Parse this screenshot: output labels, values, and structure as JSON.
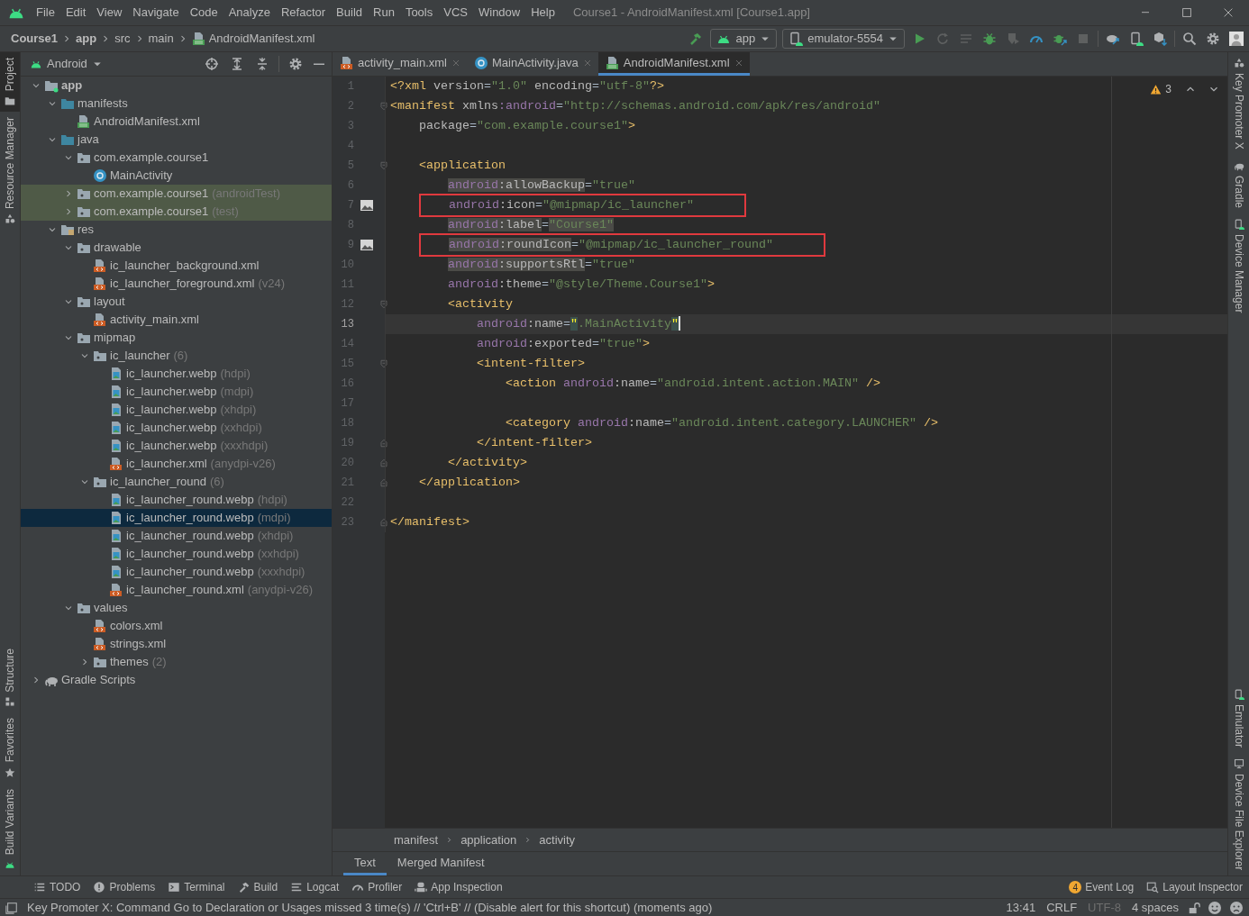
{
  "window": {
    "title": "Course1 - AndroidManifest.xml [Course1.app]"
  },
  "menu": [
    "File",
    "Edit",
    "View",
    "Navigate",
    "Code",
    "Analyze",
    "Refactor",
    "Build",
    "Run",
    "Tools",
    "VCS",
    "Window",
    "Help"
  ],
  "breadcrumb": [
    {
      "text": "Course1",
      "bold": true,
      "kind": "plain"
    },
    {
      "text": "app",
      "bold": true,
      "kind": "plain"
    },
    {
      "text": "src",
      "bold": false,
      "kind": "plain"
    },
    {
      "text": "main",
      "bold": false,
      "kind": "plain"
    },
    {
      "text": "AndroidManifest.xml",
      "bold": false,
      "kind": "manifest"
    }
  ],
  "run_config": "app",
  "device": "emulator-5554",
  "left_strip": {
    "top": [
      {
        "label": "Project",
        "selected": true
      },
      {
        "label": "Resource Manager",
        "selected": false
      }
    ],
    "bottom": [
      {
        "label": "Structure",
        "selected": false
      },
      {
        "label": "Favorites",
        "selected": false
      },
      {
        "label": "Build Variants",
        "selected": false
      }
    ]
  },
  "right_strip": {
    "top": [
      "Key Promoter X",
      "Gradle",
      "Device Manager"
    ],
    "bottom": [
      "Emulator",
      "Device File Explorer"
    ]
  },
  "project": {
    "view": "Android",
    "tree": [
      {
        "label": "app",
        "kind": "module",
        "expanded": true,
        "selected": false,
        "tinted": false,
        "children": [
          {
            "label": "manifests",
            "kind": "folder-blue",
            "expanded": true,
            "selected": false,
            "tinted": false,
            "children": [
              {
                "label": "AndroidManifest.xml",
                "kind": "manifest",
                "selected": false,
                "tinted": false
              }
            ]
          },
          {
            "label": "java",
            "kind": "folder-blue",
            "expanded": true,
            "selected": false,
            "tinted": false,
            "children": [
              {
                "label": "com.example.course1",
                "kind": "package",
                "expanded": true,
                "selected": false,
                "tinted": false,
                "children": [
                  {
                    "label": "MainActivity",
                    "kind": "class",
                    "selected": false,
                    "tinted": false
                  }
                ]
              },
              {
                "label": "com.example.course1",
                "note": "(androidTest)",
                "kind": "package",
                "expanded": false,
                "selected": false,
                "tinted": true
              },
              {
                "label": "com.example.course1",
                "note": "(test)",
                "kind": "package",
                "expanded": false,
                "selected": false,
                "tinted": true
              }
            ]
          },
          {
            "label": "res",
            "kind": "res",
            "expanded": true,
            "selected": false,
            "tinted": false,
            "children": [
              {
                "label": "drawable",
                "kind": "package",
                "expanded": true,
                "selected": false,
                "tinted": false,
                "children": [
                  {
                    "label": "ic_launcher_background.xml",
                    "kind": "xml",
                    "selected": false,
                    "tinted": false
                  },
                  {
                    "label": "ic_launcher_foreground.xml",
                    "note": "(v24)",
                    "kind": "xml",
                    "selected": false,
                    "tinted": false
                  }
                ]
              },
              {
                "label": "layout",
                "kind": "package",
                "expanded": true,
                "selected": false,
                "tinted": false,
                "children": [
                  {
                    "label": "activity_main.xml",
                    "kind": "xml",
                    "selected": false,
                    "tinted": false
                  }
                ]
              },
              {
                "label": "mipmap",
                "kind": "package",
                "expanded": true,
                "selected": false,
                "tinted": false,
                "children": [
                  {
                    "label": "ic_launcher",
                    "note": "(6)",
                    "kind": "package",
                    "expanded": true,
                    "selected": false,
                    "tinted": false,
                    "children": [
                      {
                        "label": "ic_launcher.webp",
                        "note": "(hdpi)",
                        "kind": "image",
                        "selected": false,
                        "tinted": false
                      },
                      {
                        "label": "ic_launcher.webp",
                        "note": "(mdpi)",
                        "kind": "image",
                        "selected": false,
                        "tinted": false
                      },
                      {
                        "label": "ic_launcher.webp",
                        "note": "(xhdpi)",
                        "kind": "image",
                        "selected": false,
                        "tinted": false
                      },
                      {
                        "label": "ic_launcher.webp",
                        "note": "(xxhdpi)",
                        "kind": "image",
                        "selected": false,
                        "tinted": false
                      },
                      {
                        "label": "ic_launcher.webp",
                        "note": "(xxxhdpi)",
                        "kind": "image",
                        "selected": false,
                        "tinted": false
                      },
                      {
                        "label": "ic_launcher.xml",
                        "note": "(anydpi-v26)",
                        "kind": "xml",
                        "selected": false,
                        "tinted": false
                      }
                    ]
                  },
                  {
                    "label": "ic_launcher_round",
                    "note": "(6)",
                    "kind": "package",
                    "expanded": true,
                    "selected": false,
                    "tinted": false,
                    "children": [
                      {
                        "label": "ic_launcher_round.webp",
                        "note": "(hdpi)",
                        "kind": "image",
                        "selected": false,
                        "tinted": false
                      },
                      {
                        "label": "ic_launcher_round.webp",
                        "note": "(mdpi)",
                        "kind": "image",
                        "selected": true,
                        "tinted": false
                      },
                      {
                        "label": "ic_launcher_round.webp",
                        "note": "(xhdpi)",
                        "kind": "image",
                        "selected": false,
                        "tinted": false
                      },
                      {
                        "label": "ic_launcher_round.webp",
                        "note": "(xxhdpi)",
                        "kind": "image",
                        "selected": false,
                        "tinted": false
                      },
                      {
                        "label": "ic_launcher_round.webp",
                        "note": "(xxxhdpi)",
                        "kind": "image",
                        "selected": false,
                        "tinted": false
                      },
                      {
                        "label": "ic_launcher_round.xml",
                        "note": "(anydpi-v26)",
                        "kind": "xml",
                        "selected": false,
                        "tinted": false
                      }
                    ]
                  }
                ]
              },
              {
                "label": "values",
                "kind": "package",
                "expanded": true,
                "selected": false,
                "tinted": false,
                "children": [
                  {
                    "label": "colors.xml",
                    "kind": "xml",
                    "selected": false,
                    "tinted": false
                  },
                  {
                    "label": "strings.xml",
                    "kind": "xml",
                    "selected": false,
                    "tinted": false
                  },
                  {
                    "label": "themes",
                    "note": "(2)",
                    "kind": "package",
                    "expanded": false,
                    "selected": false,
                    "tinted": false
                  }
                ]
              }
            ]
          }
        ]
      },
      {
        "label": "Gradle Scripts",
        "kind": "gradle",
        "expanded": false,
        "selected": false,
        "tinted": false
      }
    ]
  },
  "editor": {
    "tabs": [
      {
        "label": "activity_main.xml",
        "kind": "xml",
        "selected": false
      },
      {
        "label": "MainActivity.java",
        "kind": "class",
        "selected": false
      },
      {
        "label": "AndroidManifest.xml",
        "kind": "manifest",
        "selected": true
      }
    ],
    "warnings": "3",
    "lines": [
      {
        "number": "1",
        "current": false,
        "boxed": false,
        "gutter_icon": false,
        "tokens": [
          {
            "kind": "tag",
            "text": "<?xml"
          },
          {
            "kind": "attr",
            "text": " version"
          },
          {
            "kind": "p",
            "text": "="
          },
          {
            "kind": "str",
            "text": "\"1.0\""
          },
          {
            "kind": "attr",
            "text": " encoding"
          },
          {
            "kind": "p",
            "text": "="
          },
          {
            "kind": "str",
            "text": "\"utf-8\""
          },
          {
            "kind": "tag",
            "text": "?>"
          }
        ]
      },
      {
        "number": "2",
        "current": false,
        "boxed": false,
        "gutter_icon": false,
        "fold": {
          "kind": "start"
        },
        "tokens": [
          {
            "kind": "tag",
            "text": "<manifest"
          },
          {
            "kind": "attr",
            "text": " xmlns"
          },
          {
            "kind": "ns",
            "text": ":android"
          },
          {
            "kind": "p",
            "text": "="
          },
          {
            "kind": "str",
            "text": "\"http://schemas.android.com/apk/res/android\""
          }
        ]
      },
      {
        "number": "3",
        "current": false,
        "boxed": false,
        "gutter_icon": false,
        "tokens": [
          {
            "kind": "attr",
            "text": "    package"
          },
          {
            "kind": "p",
            "text": "="
          },
          {
            "kind": "str",
            "text": "\"com.example.course1\""
          },
          {
            "kind": "tag",
            "text": ">"
          }
        ]
      },
      {
        "number": "4",
        "current": false,
        "boxed": false,
        "gutter_icon": false
      },
      {
        "number": "5",
        "current": false,
        "boxed": false,
        "gutter_icon": false,
        "fold": {
          "kind": "start"
        },
        "tokens": [
          {
            "kind": "tag",
            "text": "    <application"
          }
        ]
      },
      {
        "number": "6",
        "current": false,
        "boxed": false,
        "gutter_icon": false,
        "tokens": [
          {
            "kind": "ns_hl",
            "text": "        android"
          },
          {
            "kind": "attr_hl",
            "text": ":allowBackup"
          },
          {
            "kind": "p",
            "text": "="
          },
          {
            "kind": "str",
            "text": "\"true\""
          }
        ]
      },
      {
        "number": "7",
        "current": false,
        "boxed": true,
        "gutter_icon": true,
        "tokens": [
          {
            "kind": "ns",
            "text": "        android"
          },
          {
            "kind": "attr",
            "text": ":icon"
          },
          {
            "kind": "p",
            "text": "="
          },
          {
            "kind": "str",
            "text": "\"@mipmap/ic_launcher\""
          }
        ]
      },
      {
        "number": "8",
        "current": false,
        "boxed": false,
        "gutter_icon": false,
        "tokens": [
          {
            "kind": "ns_hl",
            "text": "        android"
          },
          {
            "kind": "attr_hl",
            "text": ":label"
          },
          {
            "kind": "p",
            "text": "="
          },
          {
            "kind": "str_hl",
            "text": "\"Course1\""
          }
        ]
      },
      {
        "number": "9",
        "current": false,
        "boxed": true,
        "gutter_icon": true,
        "tokens": [
          {
            "kind": "ns_hl",
            "text": "        android"
          },
          {
            "kind": "attr_hl",
            "text": ":roundIcon"
          },
          {
            "kind": "p",
            "text": "="
          },
          {
            "kind": "str",
            "text": "\"@mipmap/ic_launcher_round\""
          }
        ]
      },
      {
        "number": "10",
        "current": false,
        "boxed": false,
        "gutter_icon": false,
        "tokens": [
          {
            "kind": "ns_hl",
            "text": "        android"
          },
          {
            "kind": "attr_hl",
            "text": ":supportsRtl"
          },
          {
            "kind": "p",
            "text": "="
          },
          {
            "kind": "str",
            "text": "\"true\""
          }
        ]
      },
      {
        "number": "11",
        "current": false,
        "boxed": false,
        "gutter_icon": false,
        "tokens": [
          {
            "kind": "ns",
            "text": "        android"
          },
          {
            "kind": "attr",
            "text": ":theme"
          },
          {
            "kind": "p",
            "text": "="
          },
          {
            "kind": "str",
            "text": "\"@style/Theme.Course1\""
          },
          {
            "kind": "tag",
            "text": ">"
          }
        ]
      },
      {
        "number": "12",
        "current": false,
        "boxed": false,
        "gutter_icon": false,
        "fold": {
          "kind": "start"
        },
        "tokens": [
          {
            "kind": "tag",
            "text": "        <activity"
          }
        ]
      },
      {
        "number": "13",
        "current": true,
        "boxed": false,
        "gutter_icon": false,
        "caret": true,
        "tokens": [
          {
            "kind": "ns",
            "text": "            android"
          },
          {
            "kind": "attr",
            "text": ":name"
          },
          {
            "kind": "p",
            "text": "="
          },
          {
            "kind": "quote_hl",
            "text": "\""
          },
          {
            "kind": "str",
            "text": ".MainActivity"
          },
          {
            "kind": "quote_hl",
            "text": "\""
          }
        ]
      },
      {
        "number": "14",
        "current": false,
        "boxed": false,
        "gutter_icon": false,
        "tokens": [
          {
            "kind": "ns",
            "text": "            android"
          },
          {
            "kind": "attr",
            "text": ":exported"
          },
          {
            "kind": "p",
            "text": "="
          },
          {
            "kind": "str",
            "text": "\"true\""
          },
          {
            "kind": "tag",
            "text": ">"
          }
        ]
      },
      {
        "number": "15",
        "current": false,
        "boxed": false,
        "gutter_icon": false,
        "fold": {
          "kind": "start"
        },
        "tokens": [
          {
            "kind": "tag",
            "text": "            <intent-filter>"
          }
        ]
      },
      {
        "number": "16",
        "current": false,
        "boxed": false,
        "gutter_icon": false,
        "tokens": [
          {
            "kind": "tag",
            "text": "                <action"
          },
          {
            "kind": "ns",
            "text": " android"
          },
          {
            "kind": "attr",
            "text": ":name"
          },
          {
            "kind": "p",
            "text": "="
          },
          {
            "kind": "str",
            "text": "\"android.intent.action.MAIN\""
          },
          {
            "kind": "tag",
            "text": " />"
          }
        ]
      },
      {
        "number": "17",
        "current": false,
        "boxed": false,
        "gutter_icon": false
      },
      {
        "number": "18",
        "current": false,
        "boxed": false,
        "gutter_icon": false,
        "tokens": [
          {
            "kind": "tag",
            "text": "                <category"
          },
          {
            "kind": "ns",
            "text": " android"
          },
          {
            "kind": "attr",
            "text": ":name"
          },
          {
            "kind": "p",
            "text": "="
          },
          {
            "kind": "str",
            "text": "\"android.intent.category.LAUNCHER\""
          },
          {
            "kind": "tag",
            "text": " />"
          }
        ]
      },
      {
        "number": "19",
        "current": false,
        "boxed": false,
        "gutter_icon": false,
        "fold": {
          "kind": "end"
        },
        "tokens": [
          {
            "kind": "tag",
            "text": "            </intent-filter>"
          }
        ]
      },
      {
        "number": "20",
        "current": false,
        "boxed": false,
        "gutter_icon": false,
        "fold": {
          "kind": "end"
        },
        "tokens": [
          {
            "kind": "tag",
            "text": "        </activity>"
          }
        ]
      },
      {
        "number": "21",
        "current": false,
        "boxed": false,
        "gutter_icon": false,
        "fold": {
          "kind": "end"
        },
        "tokens": [
          {
            "kind": "tag",
            "text": "    </application>"
          }
        ]
      },
      {
        "number": "22",
        "current": false,
        "boxed": false,
        "gutter_icon": false
      },
      {
        "number": "23",
        "current": false,
        "boxed": false,
        "gutter_icon": false,
        "fold": {
          "kind": "end"
        },
        "tokens": [
          {
            "kind": "tag",
            "text": "</manifest>"
          }
        ]
      }
    ],
    "path": [
      "manifest",
      "application",
      "activity"
    ],
    "bottom_tabs": [
      {
        "label": "Text",
        "selected": true
      },
      {
        "label": "Merged Manifest",
        "selected": false
      }
    ]
  },
  "tool_buttons": {
    "left": [
      {
        "label": "TODO",
        "kind": "list"
      },
      {
        "label": "Problems",
        "kind": "alert"
      },
      {
        "label": "Terminal",
        "kind": "terminal"
      },
      {
        "label": "Build",
        "kind": "hammer"
      },
      {
        "label": "Logcat",
        "kind": "lines"
      },
      {
        "label": "Profiler",
        "kind": "gauge"
      },
      {
        "label": "App Inspection",
        "kind": "robot"
      }
    ],
    "right": [
      {
        "label": "Event Log",
        "kind": "badge",
        "badge": "4"
      },
      {
        "label": "Layout Inspector",
        "kind": "inspect"
      }
    ]
  },
  "status_bar": {
    "message": "Key Promoter X: Command Go to Declaration or Usages missed 3 time(s) // 'Ctrl+B' // (Disable alert for this shortcut) (moments ago)",
    "items": [
      {
        "text": "13:41",
        "dimmed": false
      },
      {
        "text": "CRLF",
        "dimmed": false
      },
      {
        "text": "UTF-8",
        "dimmed": true
      },
      {
        "text": "4 spaces",
        "dimmed": false
      }
    ]
  }
}
